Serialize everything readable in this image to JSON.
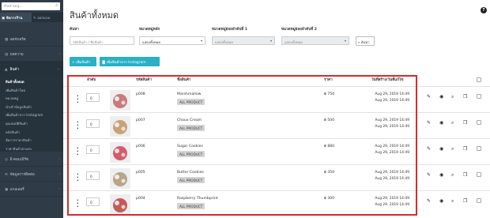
{
  "sidebar": {
    "search_placeholder": "ค้นหาเมนู...",
    "tabs": [
      {
        "label": "จัดการร้าน"
      },
      {
        "label": "ออกแบบ"
      }
    ],
    "menu": [
      {
        "label": "แดชบอร์ด",
        "icon": "dashboard-icon"
      },
      {
        "label": "บทความ",
        "icon": "article-icon"
      },
      {
        "label": "สินค้า",
        "icon": "product-icon"
      }
    ],
    "submenu": [
      {
        "label": "สินค้าทั้งหมด"
      },
      {
        "label": "เพิ่มสินค้าใหม่"
      },
      {
        "label": "หมวดหมู่"
      },
      {
        "label": "นำเข้าข้อมูลสินค้า"
      },
      {
        "label": "เพิ่มสินค้าจาก Instagram"
      },
      {
        "label": "คุณสมบัติสินค้า"
      },
      {
        "label": "คลังสินค้า"
      },
      {
        "label": "จัดการราคาสินค้า"
      },
      {
        "label": "ราคาสินค้าตามส่ง"
      }
    ],
    "menu_after": [
      {
        "label": "อี-คอมเมิร์ซ",
        "icon": "cart-icon"
      },
      {
        "label": "ข้อมูลการติดต่อ",
        "icon": "contact-icon"
      },
      {
        "label": "แกลเลอรี่",
        "icon": "gallery-icon"
      }
    ]
  },
  "main": {
    "title": "สินค้าทั้งหมด",
    "filters": {
      "search_label": "ค้นหา",
      "search_placeholder": "รหัสสินค้า / ชื่อสินค้า",
      "main_cat_label": "หมวดหมู่หลัก",
      "main_cat_value": "แสดงทั้งหมด",
      "sub1_label": "หมวดหมู่ย่อยลำดับที่ 1",
      "sub1_value": "แสดงทั้งหมด",
      "sub2_label": "หมวดหมู่ย่อยลำดับที่ 2",
      "sub2_value": "แสดงทั้งหมด",
      "search_button": "ค้นหา"
    },
    "buttons": {
      "add_product": "+ เพิ่มสินค้า",
      "add_from_instagram": "เพิ่มสินค้าจาก Instagram"
    },
    "table": {
      "headers": {
        "order": "ลำดับ",
        "code": "รหัสสินค้า",
        "name": "ชื่อสินค้า",
        "price": "ราคา",
        "dates": "วันที่สร้าง/วันที่แก้ไข"
      },
      "rows": [
        {
          "order": "0",
          "code": "p008",
          "name": "Marshmallow",
          "category": "ALL PRODUCT",
          "price": "฿ 750",
          "created": "Aug 29, 2019 14:49",
          "updated": "Aug 29, 2019 14:49",
          "thumb_color": "#c97a7a"
        },
        {
          "order": "0",
          "code": "p007",
          "name": "Choux Cream",
          "category": "ALL PRODUCT",
          "price": "฿ 500",
          "created": "Aug 29, 2019 14:49",
          "updated": "Aug 29, 2019 14:49",
          "thumb_color": "#c9a27a"
        },
        {
          "order": "0",
          "code": "p006",
          "name": "Sugar Cookies",
          "category": "ALL PRODUCT",
          "price": "฿ 880",
          "created": "Aug 29, 2019 14:49",
          "updated": "Aug 29, 2019 14:49",
          "thumb_color": "#d65a6a"
        },
        {
          "order": "0",
          "code": "p005",
          "name": "Butter Cookies",
          "category": "ALL PRODUCT",
          "price": "฿ 350",
          "created": "Aug 29, 2019 14:49",
          "updated": "Aug 29, 2019 14:49",
          "thumb_color": "#b9a48a"
        },
        {
          "order": "0",
          "code": "p004",
          "name": "Raspberry Thumbprint",
          "category": "ALL PRODUCT",
          "price": "฿ 300",
          "created": "Aug 29, 2019 14:49",
          "updated": "Aug 29, 2019 14:49",
          "thumb_color": "#c25a5a"
        }
      ]
    }
  },
  "colors": {
    "sidebar_bg": "#2f3b46",
    "accent": "#29b0c4",
    "highlight": "#d62b2b"
  }
}
